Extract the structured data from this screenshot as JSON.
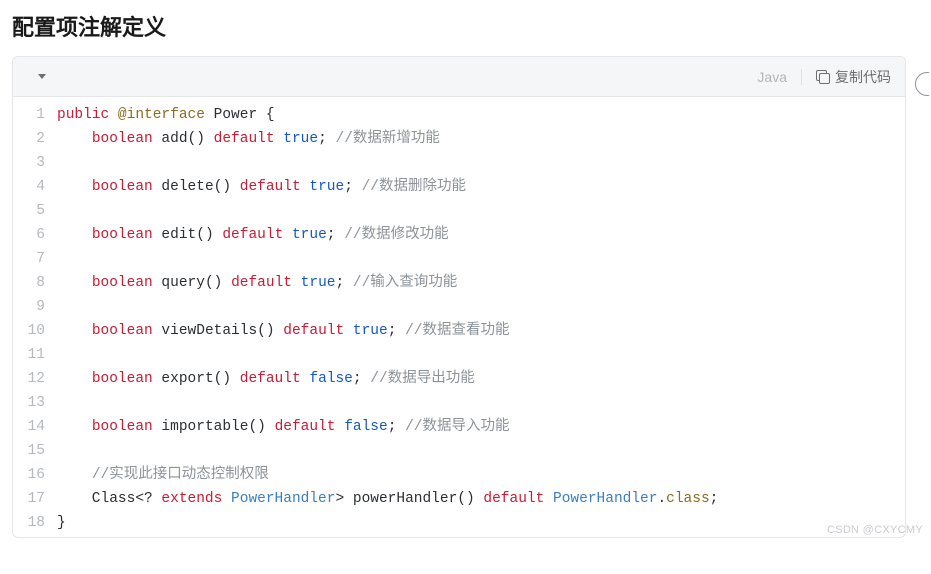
{
  "title": "配置项注解定义",
  "language": "Java",
  "copy_label": "复制代码",
  "watermark": "CSDN @CXYCMY",
  "code": {
    "lines": [
      [
        {
          "t": "public",
          "c": "kw"
        },
        {
          "t": " "
        },
        {
          "t": "@interface",
          "c": "annot"
        },
        {
          "t": " Power {"
        }
      ],
      [
        {
          "t": "    "
        },
        {
          "t": "boolean",
          "c": "kw"
        },
        {
          "t": " add() "
        },
        {
          "t": "default",
          "c": "kw"
        },
        {
          "t": " "
        },
        {
          "t": "true",
          "c": "lit"
        },
        {
          "t": "; "
        },
        {
          "t": "//数据新增功能",
          "c": "cmt"
        }
      ],
      [],
      [
        {
          "t": "    "
        },
        {
          "t": "boolean",
          "c": "kw"
        },
        {
          "t": " delete() "
        },
        {
          "t": "default",
          "c": "kw"
        },
        {
          "t": " "
        },
        {
          "t": "true",
          "c": "lit"
        },
        {
          "t": "; "
        },
        {
          "t": "//数据删除功能",
          "c": "cmt"
        }
      ],
      [],
      [
        {
          "t": "    "
        },
        {
          "t": "boolean",
          "c": "kw"
        },
        {
          "t": " edit() "
        },
        {
          "t": "default",
          "c": "kw"
        },
        {
          "t": " "
        },
        {
          "t": "true",
          "c": "lit"
        },
        {
          "t": "; "
        },
        {
          "t": "//数据修改功能",
          "c": "cmt"
        }
      ],
      [],
      [
        {
          "t": "    "
        },
        {
          "t": "boolean",
          "c": "kw"
        },
        {
          "t": " query() "
        },
        {
          "t": "default",
          "c": "kw"
        },
        {
          "t": " "
        },
        {
          "t": "true",
          "c": "lit"
        },
        {
          "t": "; "
        },
        {
          "t": "//输入查询功能",
          "c": "cmt"
        }
      ],
      [],
      [
        {
          "t": "    "
        },
        {
          "t": "boolean",
          "c": "kw"
        },
        {
          "t": " viewDetails() "
        },
        {
          "t": "default",
          "c": "kw"
        },
        {
          "t": " "
        },
        {
          "t": "true",
          "c": "lit"
        },
        {
          "t": "; "
        },
        {
          "t": "//数据查看功能",
          "c": "cmt"
        }
      ],
      [],
      [
        {
          "t": "    "
        },
        {
          "t": "boolean",
          "c": "kw"
        },
        {
          "t": " export() "
        },
        {
          "t": "default",
          "c": "kw"
        },
        {
          "t": " "
        },
        {
          "t": "false",
          "c": "lit"
        },
        {
          "t": "; "
        },
        {
          "t": "//数据导出功能",
          "c": "cmt"
        }
      ],
      [],
      [
        {
          "t": "    "
        },
        {
          "t": "boolean",
          "c": "kw"
        },
        {
          "t": " importable() "
        },
        {
          "t": "default",
          "c": "kw"
        },
        {
          "t": " "
        },
        {
          "t": "false",
          "c": "lit"
        },
        {
          "t": "; "
        },
        {
          "t": "//数据导入功能",
          "c": "cmt"
        }
      ],
      [],
      [
        {
          "t": "    "
        },
        {
          "t": "//实现此接口动态控制权限",
          "c": "cmt"
        }
      ],
      [
        {
          "t": "    Class<? "
        },
        {
          "t": "extends",
          "c": "kw"
        },
        {
          "t": " "
        },
        {
          "t": "PowerHandler",
          "c": "type"
        },
        {
          "t": "> powerHandler() "
        },
        {
          "t": "default",
          "c": "kw"
        },
        {
          "t": " "
        },
        {
          "t": "PowerHandler",
          "c": "type"
        },
        {
          "t": "."
        },
        {
          "t": "class",
          "c": "class"
        },
        {
          "t": ";"
        }
      ],
      [
        {
          "t": "}"
        }
      ]
    ]
  }
}
